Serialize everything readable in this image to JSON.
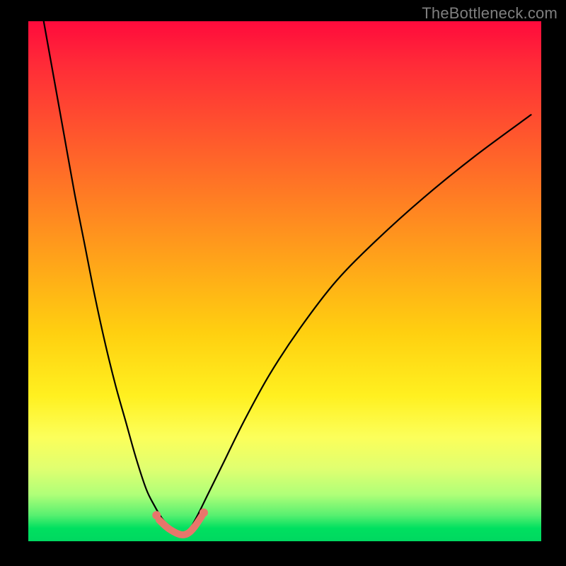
{
  "watermark": "TheBottleneck.com",
  "chart_data": {
    "type": "line",
    "title": "",
    "xlabel": "",
    "ylabel": "",
    "xlim": [
      0,
      100
    ],
    "ylim": [
      0,
      100
    ],
    "grid": false,
    "legend": false,
    "series": [
      {
        "name": "curve-left-branch",
        "color": "#000000",
        "x": [
          3,
          5,
          7,
          9,
          11,
          13,
          15,
          17,
          19,
          21,
          23,
          24.5,
          26,
          27.3,
          28.5,
          29.5,
          30.3
        ],
        "y": [
          100,
          89,
          78,
          67,
          57,
          47,
          38,
          30,
          23,
          16,
          10,
          7,
          4.5,
          3,
          2,
          1.3,
          1
        ]
      },
      {
        "name": "curve-right-branch",
        "color": "#000000",
        "x": [
          30.3,
          31.3,
          33,
          35,
          38,
          42,
          47,
          53,
          60,
          68,
          77,
          87,
          98
        ],
        "y": [
          1,
          2,
          5,
          9,
          15,
          23,
          32,
          41,
          50,
          58,
          66,
          74,
          82
        ]
      },
      {
        "name": "red-accent-segment",
        "color": "#e8766b",
        "x": [
          25.5,
          27.0,
          28.4,
          29.6,
          30.6,
          31.5,
          32.5,
          33.8
        ],
        "y": [
          4.1,
          2.7,
          1.8,
          1.3,
          1.3,
          1.8,
          2.9,
          4.8
        ]
      }
    ],
    "points": [
      {
        "name": "red-dot-left",
        "x": 25.0,
        "y": 5.0,
        "color": "#e8766b",
        "r": 6
      },
      {
        "name": "red-dot-right",
        "x": 34.2,
        "y": 5.5,
        "color": "#e8766b",
        "r": 6
      }
    ],
    "background_gradient": {
      "direction": "vertical-top-to-bottom",
      "stops": [
        {
          "pos": 0.0,
          "color": "#ff0a3c"
        },
        {
          "pos": 0.5,
          "color": "#ffaa18"
        },
        {
          "pos": 0.8,
          "color": "#fcff5a"
        },
        {
          "pos": 1.0,
          "color": "#00d860"
        }
      ]
    }
  }
}
